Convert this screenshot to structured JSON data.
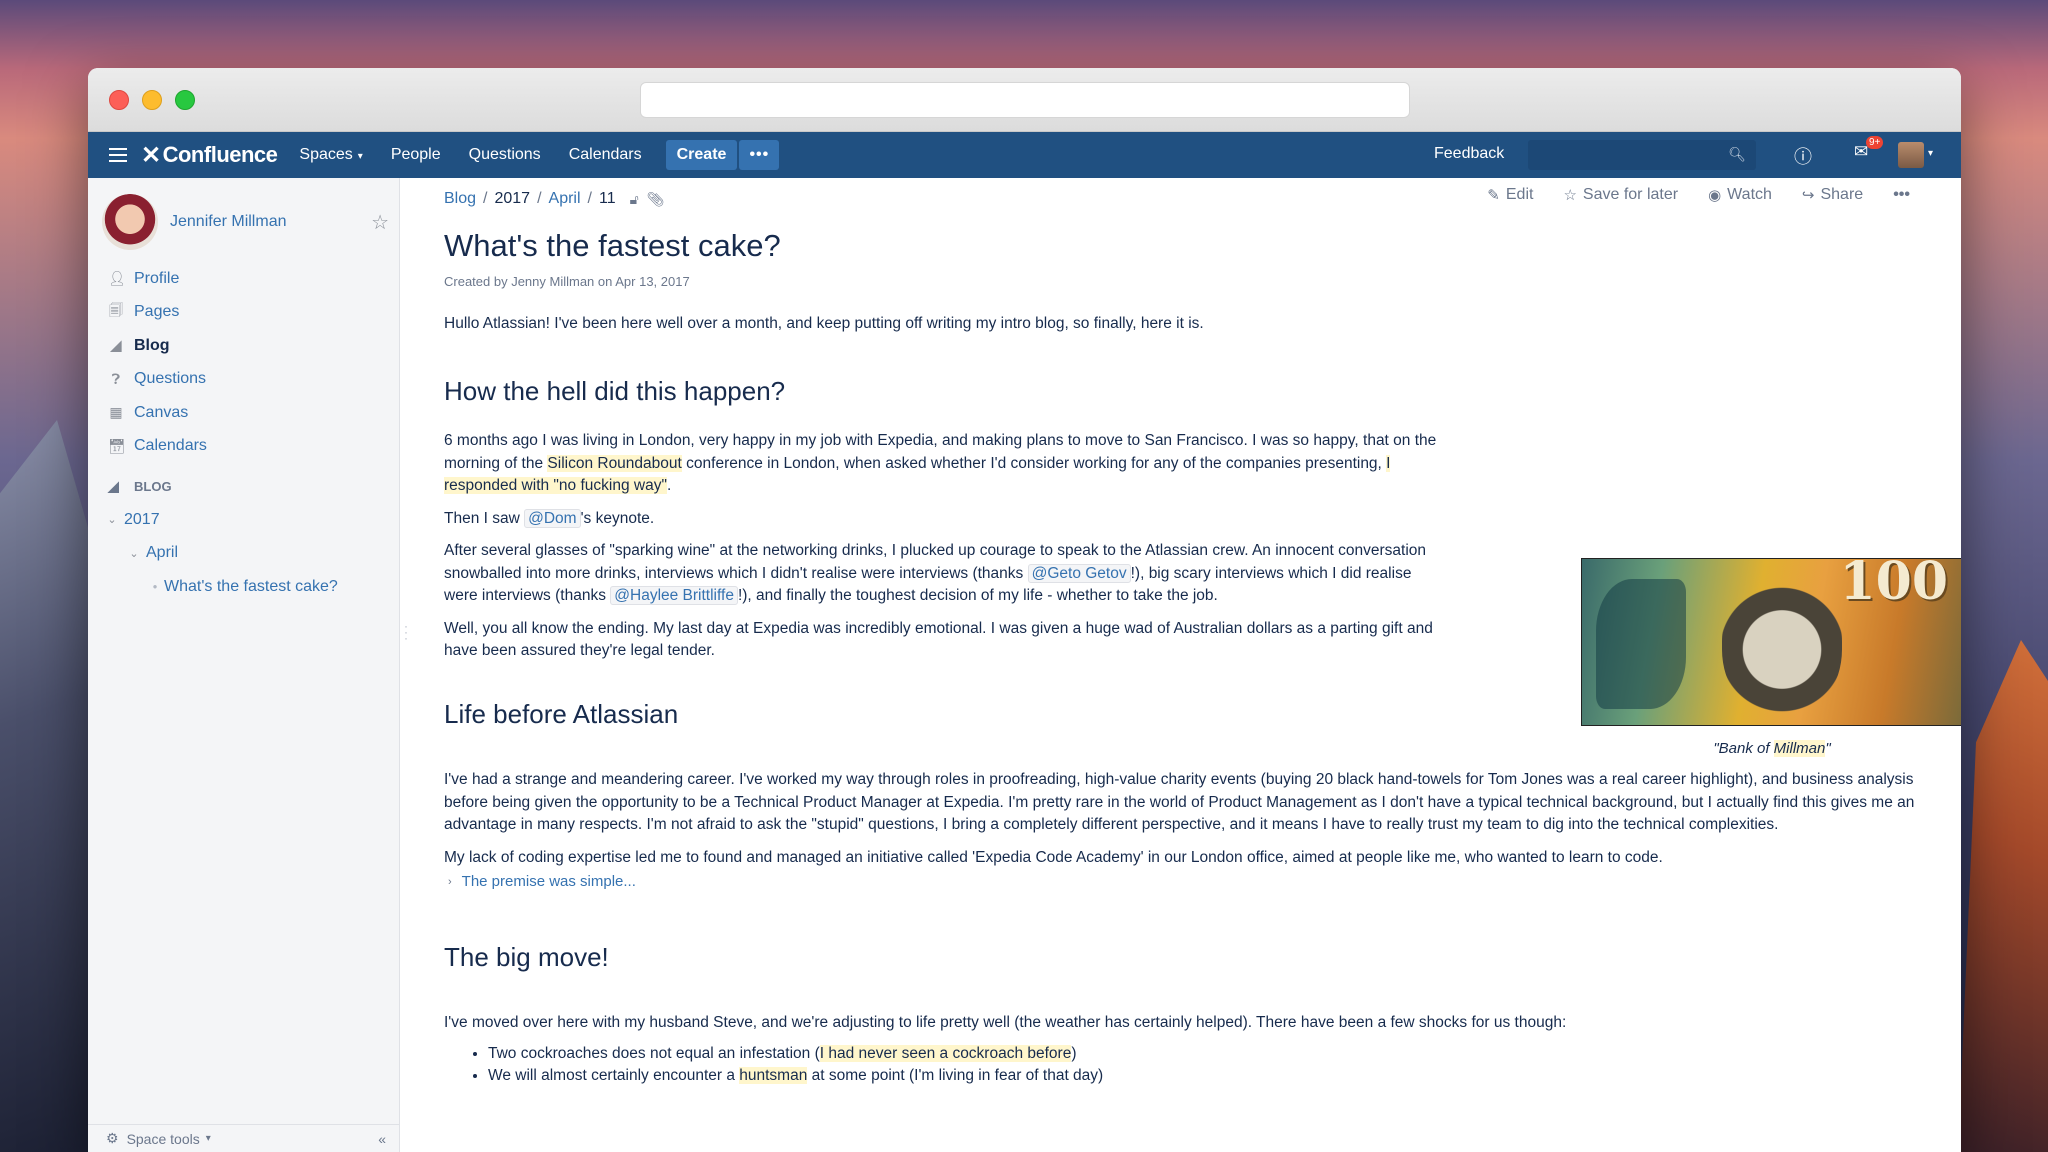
{
  "nav": {
    "brand": "Confluence",
    "items": [
      "Spaces",
      "People",
      "Questions",
      "Calendars"
    ],
    "create": "Create",
    "more": "•••",
    "feedback": "Feedback",
    "notif_badge": "9+"
  },
  "sidebar": {
    "user_name": "Jennifer Millman",
    "items": [
      {
        "label": "Profile",
        "icon": "person-icon"
      },
      {
        "label": "Pages",
        "icon": "pages-icon"
      },
      {
        "label": "Blog",
        "icon": "rss-icon"
      },
      {
        "label": "Questions",
        "icon": "question-icon"
      },
      {
        "label": "Canvas",
        "icon": "canvas-icon"
      },
      {
        "label": "Calendars",
        "icon": "calendar-icon"
      }
    ],
    "blog_heading": "BLOG",
    "tree": {
      "year": "2017",
      "month": "April",
      "post": "What's the fastest cake?"
    },
    "space_tools": "Space tools",
    "collapse": "«"
  },
  "breadcrumb": {
    "blog": "Blog",
    "year": "2017",
    "month": "April",
    "day": "11"
  },
  "actions": {
    "edit": "Edit",
    "save": "Save for later",
    "watch": "Watch",
    "share": "Share",
    "more": "•••"
  },
  "page": {
    "title": "What's the fastest cake?",
    "byline": "Created by Jenny Millman on Apr 13, 2017",
    "intro": "Hullo Atlassian! I've been here well over a month, and keep putting off writing my intro blog, so finally, here it is.",
    "h1": "How the hell did this happen?",
    "p1a": "6 months ago I was living in London, very happy in my job with Expedia, and making plans to move to San Francisco. I was so happy, that on the morning of the ",
    "p1_hl1": "Silicon Roundabout",
    "p1b": " conference in London, when asked whether I'd consider working for any of the companies presenting, ",
    "p1_hl2": "I responded with \"no fucking way\"",
    "p1c": ".",
    "p2a": "Then I saw ",
    "p2_mention": "@Dom",
    "p2b": "'s  keynote.",
    "p3a": "After several glasses of \"sparking wine\" at the networking drinks, I plucked up courage to speak to the Atlassian crew. An innocent conversation snowballed into more drinks, interviews which I didn't realise were interviews (thanks ",
    "p3_m1": "@Geto Getov",
    "p3b": "!), big scary interviews which I did realise were interviews (thanks ",
    "p3_m2": "@Haylee Brittliffe",
    "p3c": "!), and finally the toughest decision of my life - whether to take the job.",
    "p4": "Well, you all know the ending. My last day at Expedia was incredibly emotional. I was given a huge wad of Australian dollars as a parting gift and have been assured they're legal tender.",
    "caption_a": "\"Bank of ",
    "caption_hl": "Millman",
    "caption_b": "\"",
    "note_value": "100",
    "h2": "Life before Atlassian",
    "p5": "I've had a strange and meandering career. I've worked my way through roles in proofreading, high-value charity events (buying 20 black hand-towels for Tom Jones was a real career highlight), and business analysis before being given the opportunity to be a Technical Product Manager at Expedia. I'm pretty rare in the world of Product Management as I don't have a typical technical background, but I actually find this gives me an advantage in many respects. I'm not afraid to ask the \"stupid\" questions, I bring a completely different perspective, and it means I have to really trust my team to dig into the technical complexities.",
    "p6": "My lack of coding expertise led me to found and managed an initiative called 'Expedia Code Academy' in our London office, aimed at people like me, who wanted to learn to code.",
    "expand": "The premise was simple...",
    "h3": "The big move!",
    "p7": "I've moved over here with my husband Steve, and we're adjusting to life pretty well (the weather has certainly helped). There have been a few shocks for us though:",
    "li1a": "Two cockroaches does not equal an infestation (",
    "li1_hl": "I had never seen a cockroach before",
    "li1b": ")",
    "li2a": "We will almost certainly encounter a ",
    "li2_hl": "huntsman",
    "li2b": " at some point (I'm living in fear of that day)"
  }
}
